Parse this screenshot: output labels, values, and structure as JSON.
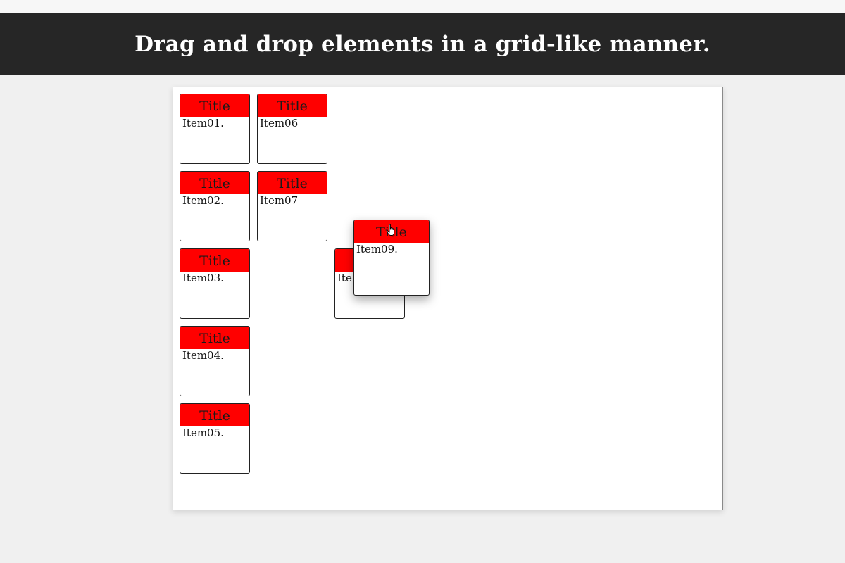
{
  "header": {
    "title": "Drag and drop elements in a grid-like manner."
  },
  "cards": [
    {
      "title": "Title",
      "body": "Item01."
    },
    {
      "title": "Title",
      "body": "Item02."
    },
    {
      "title": "Title",
      "body": "Item03."
    },
    {
      "title": "Title",
      "body": "Item04."
    },
    {
      "title": "Title",
      "body": "Item05."
    },
    {
      "title": "Title",
      "body": "Item06"
    },
    {
      "title": "Title",
      "body": "Item07"
    },
    {
      "title": "Title",
      "body": "Ite"
    },
    {
      "title": "Title",
      "body": "Item09."
    }
  ],
  "colors": {
    "header_bg": "#262626",
    "card_title_bg": "#ff0000",
    "board_bg": "#ffffff",
    "page_bg": "#f0f0f0"
  },
  "cursor": {
    "icon": "hand-pointer-icon"
  }
}
